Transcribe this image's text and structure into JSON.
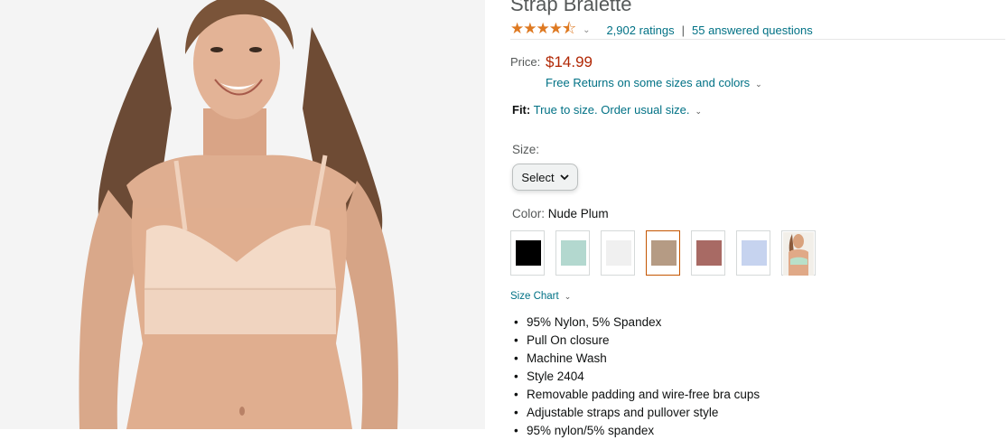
{
  "product": {
    "title": "Strap Bralette",
    "stars": "★★★★⯪",
    "rating_count": "2,902 ratings",
    "answered_questions": "55 answered questions"
  },
  "price": {
    "label": "Price:",
    "value": "$14.99",
    "returns": "Free Returns on some sizes and colors"
  },
  "fit": {
    "label": "Fit:",
    "value": "True to size. Order usual size."
  },
  "size": {
    "label": "Size:",
    "select_value": "Select"
  },
  "color": {
    "label": "Color:",
    "selected": "Nude Plum",
    "swatches": [
      {
        "color": "#000000"
      },
      {
        "color": "#b3d8cf"
      },
      {
        "color": "#f0f0f0"
      },
      {
        "color": "#b59b84"
      },
      {
        "color": "#a86a64"
      },
      {
        "color": "#c6d3ef"
      },
      {
        "color": "photo"
      }
    ]
  },
  "size_chart": "Size Chart",
  "features": [
    "95% Nylon, 5% Spandex",
    "Pull On closure",
    "Machine Wash",
    "Style 2404",
    "Removable padding and wire-free bra cups",
    "Adjustable straps and pullover style",
    "95% nylon/5% spandex"
  ],
  "icons": {
    "star_rating": "star-rating-icon",
    "chevron": "chevron-down-icon",
    "product_photo": "product-photo"
  }
}
